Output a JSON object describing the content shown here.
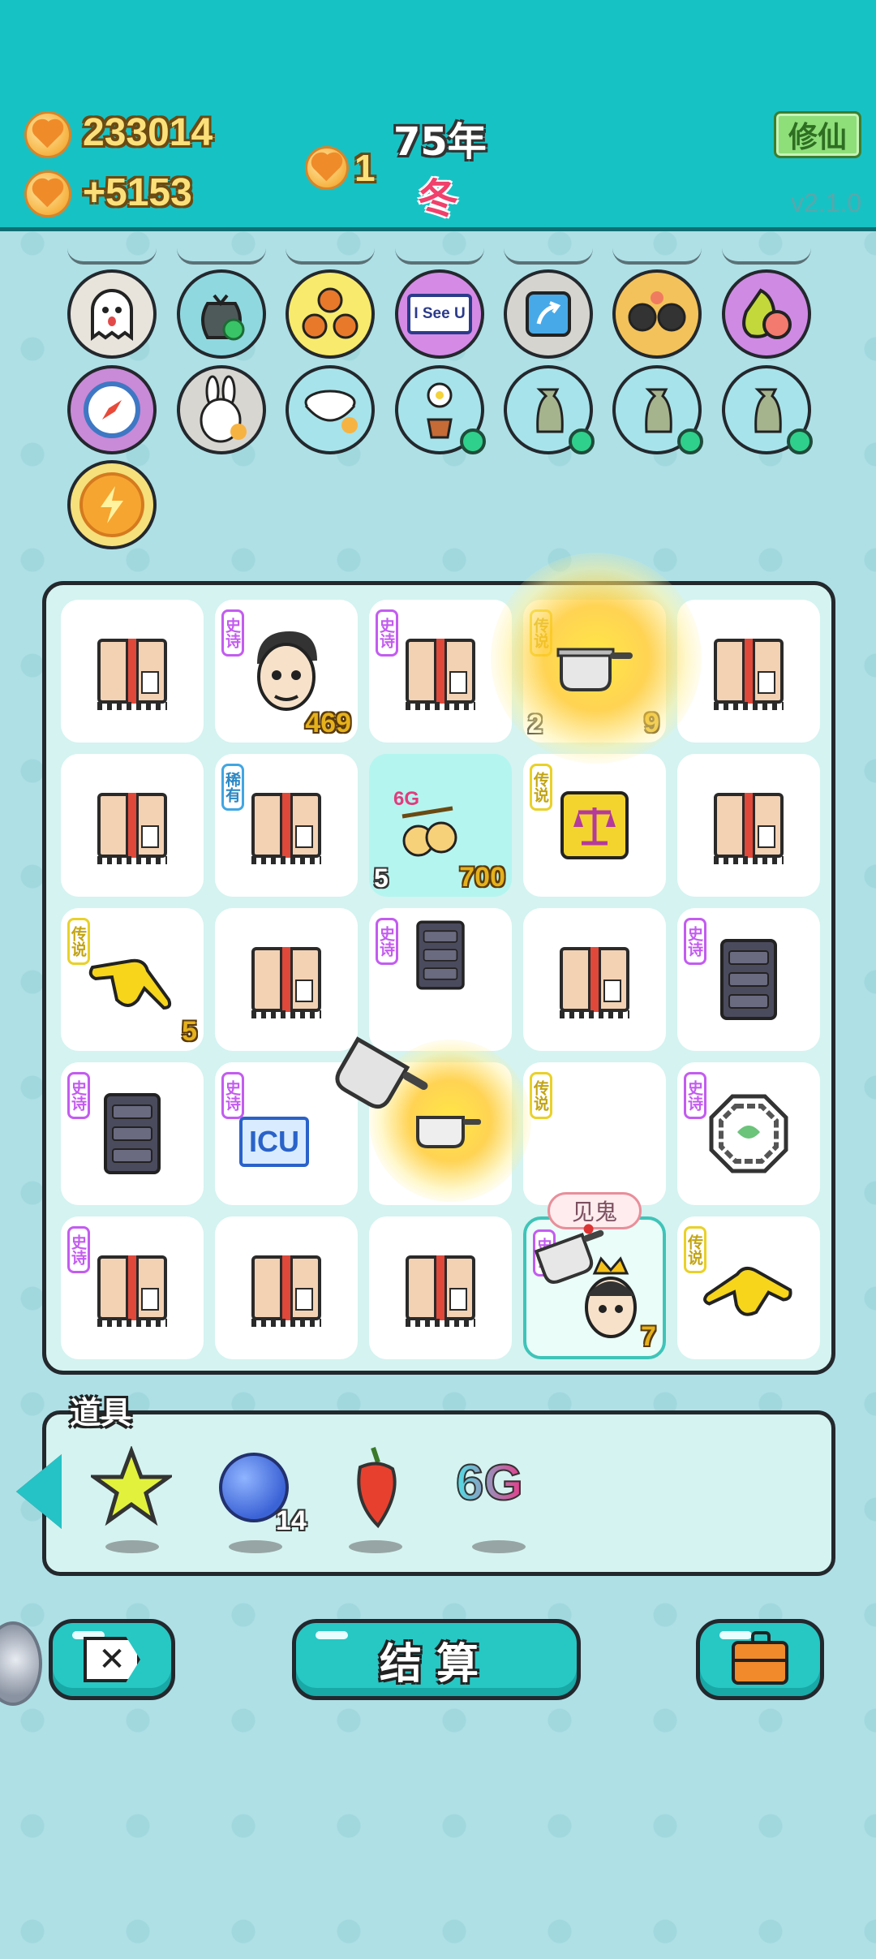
{
  "header": {
    "coins": "233014",
    "coin_rate": "+5153",
    "hearts": "1",
    "year": "75年",
    "season": "冬",
    "mode_button": "修仙",
    "version": "v2.1.0"
  },
  "items_row1": [
    "ghost-icon",
    "recycle-bag-icon",
    "basketballs-icon",
    "i-see-u-icon",
    "arrow-up-icon",
    "owl-glasses-icon",
    "grapefruit-icon"
  ],
  "items_row1_text": {
    "i_see_u": "I See U"
  },
  "items_row2": [
    "compass-icon",
    "bunny-icon",
    "rice-bowl-icon",
    "flower-pot-icon",
    "sack-icon",
    "sack-icon",
    "sack-icon"
  ],
  "items_row3": [
    "lightning-icon"
  ],
  "board": {
    "tags": {
      "epic": "史诗",
      "legend": "传说",
      "rare": "稀有"
    },
    "cells": [
      {
        "icon": "box-icon"
      },
      {
        "icon": "man-face-icon",
        "tag": "史诗",
        "count": "469"
      },
      {
        "icon": "box-icon",
        "tag": "史诗"
      },
      {
        "icon": "pot-icon",
        "tag": "传说",
        "left": "2",
        "count": "9"
      },
      {
        "icon": "box-icon"
      },
      {
        "icon": "box-icon"
      },
      {
        "icon": "box-icon",
        "tag": "稀有"
      },
      {
        "icon": "peaches-icon",
        "label": "6G",
        "left": "5",
        "count": "700"
      },
      {
        "icon": "scale-icon",
        "tag": "传说"
      },
      {
        "icon": "box-icon"
      },
      {
        "icon": "pointing-hand-icon",
        "tag": "传说",
        "count": "5"
      },
      {
        "icon": "box-icon"
      },
      {
        "icon": "server-icon",
        "tag": "史诗"
      },
      {
        "icon": "box-icon"
      },
      {
        "icon": "server-icon",
        "tag": "史诗"
      },
      {
        "icon": "server-icon",
        "tag": "史诗"
      },
      {
        "icon": "icu-icon",
        "tag": "史诗",
        "label": "ICU"
      },
      {
        "icon": "pot-icon"
      },
      {
        "icon": "empty",
        "tag": "传说"
      },
      {
        "icon": "bagua-icon",
        "tag": "史诗"
      },
      {
        "icon": "box-icon",
        "tag": "史诗"
      },
      {
        "icon": "box-icon"
      },
      {
        "icon": "box-icon"
      },
      {
        "icon": "king-face-icon",
        "tag": "史诗",
        "bubble": "见鬼",
        "count": "7"
      },
      {
        "icon": "pointing-hand-icon",
        "tag": "传说"
      }
    ]
  },
  "props": {
    "title": "道具",
    "items": [
      {
        "icon": "star-icon"
      },
      {
        "icon": "blueberry-icon",
        "count": "14"
      },
      {
        "icon": "chili-icon"
      },
      {
        "icon": "6g-icon",
        "label": "6G"
      }
    ]
  },
  "buttons": {
    "close": "close-icon",
    "settle": "结算",
    "bag": "briefcase-icon"
  },
  "colors": {
    "header": "#17c2c4",
    "accent": "#27c7c4",
    "coin_text": "#fbe07a",
    "epic": "#c35cf0",
    "legend": "#e9d129",
    "rare": "#41a6e3"
  }
}
